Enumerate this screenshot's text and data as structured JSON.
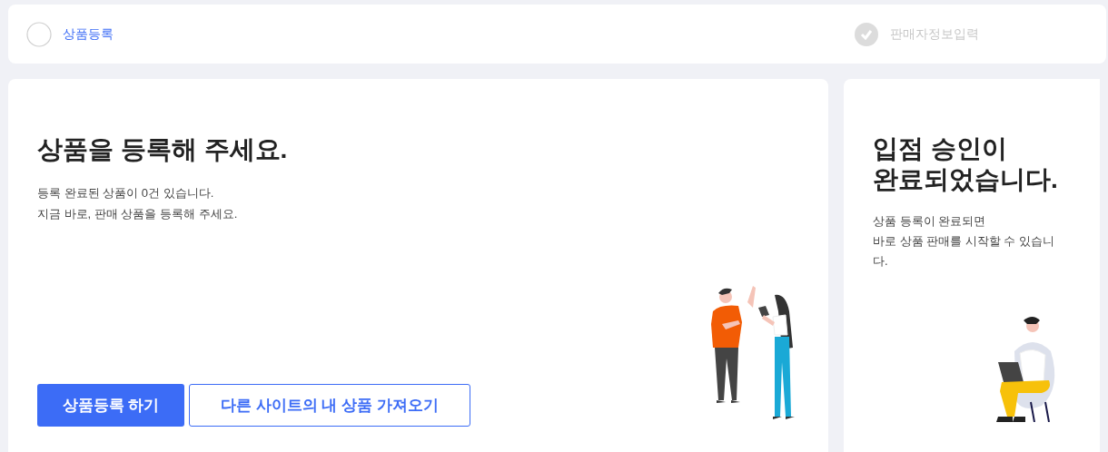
{
  "steps": [
    {
      "label": "상품등록",
      "selected": true,
      "completed": false
    },
    {
      "label": "판매자정보입력",
      "selected": false,
      "completed": true
    }
  ],
  "register_card": {
    "title": "상품을 등록해 주세요.",
    "lines": [
      "등록 완료된 상품이 0건 있습니다.",
      "지금 바로, 판매 상품을 등록해 주세요."
    ],
    "buttons": [
      {
        "label": "상품등록 하기",
        "kind": "primary"
      },
      {
        "label": "다른 사이트의 내 상품 가져오기",
        "kind": "outline"
      }
    ]
  },
  "approval_card": {
    "title_lines": [
      "입점 승인이",
      "완료되었습니다."
    ],
    "lines": [
      "상품 등록이 완료되면",
      "바로 상품 판매를 시작할 수 있습니다."
    ]
  }
}
